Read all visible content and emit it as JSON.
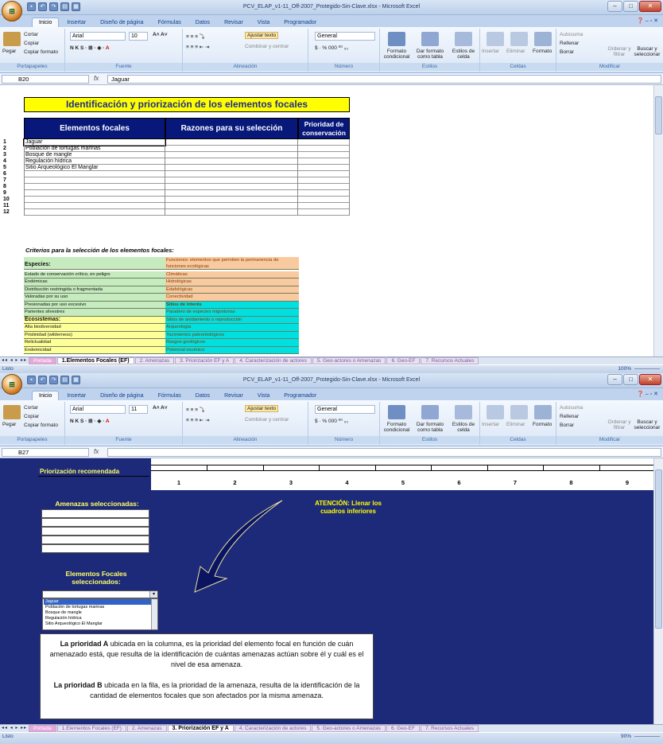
{
  "window1": {
    "title": "PCV_ELAP_v1-11_Off-2007_Protegido-Sin-Clave.xlsx - Microsoft Excel",
    "tabs": [
      "Inicio",
      "Insertar",
      "Diseño de página",
      "Fórmulas",
      "Datos",
      "Revisar",
      "Vista",
      "Programador"
    ],
    "ribbon": {
      "cortar": "Cortar",
      "copiar": "Copiar",
      "copiar_formato": "Copiar formato",
      "pegar": "Pegar",
      "font": "Arial",
      "size": "10",
      "ajustar": "Ajustar texto",
      "combinar": "Combinar y centrar",
      "general": "General",
      "formato_cond": "Formato condicional",
      "dar_formato": "Dar formato como tabla",
      "estilos_celda": "Estilos de celda",
      "insertar": "Insertar",
      "eliminar": "Eliminar",
      "formato": "Formato",
      "autosuma": "Autosuma",
      "rellenar": "Rellenar",
      "borrar": "Borrar",
      "ordenar": "Ordenar y filtrar",
      "buscar": "Buscar y seleccionar",
      "g_portapapeles": "Portapapeles",
      "g_fuente": "Fuente",
      "g_alineacion": "Alineación",
      "g_numero": "Número",
      "g_estilos": "Estilos",
      "g_celdas": "Celdas",
      "g_modificar": "Modificar"
    },
    "namebox": "B20",
    "formula": "Jaguar",
    "heading": "Identificación y priorización de los elementos focales",
    "col1": "Elementos focales",
    "col2": "Razones para su selección",
    "col3": "Prioridad de conservación",
    "rows": [
      {
        "n": "1",
        "v": "Jaguar"
      },
      {
        "n": "2",
        "v": "Población de tortugas marinas"
      },
      {
        "n": "3",
        "v": "Bosque de mangle"
      },
      {
        "n": "4",
        "v": "Regulación hídrica"
      },
      {
        "n": "5",
        "v": "Sitio Arqueológico El Manglar"
      },
      {
        "n": "6",
        "v": ""
      },
      {
        "n": "7",
        "v": ""
      },
      {
        "n": "8",
        "v": ""
      },
      {
        "n": "9",
        "v": ""
      },
      {
        "n": "10",
        "v": ""
      },
      {
        "n": "11",
        "v": ""
      },
      {
        "n": "12",
        "v": ""
      }
    ],
    "criteria_title": "Criterios para la selección de los elementos focales:",
    "crit_left": [
      "Especies:",
      "Estado de conservación crítico, en peligro",
      "Endémicas",
      "Distribución restringida o fragmentada",
      "Valoradas por su uso",
      "Presionadas por uso excesivo",
      "Parientes silvestres",
      "Ecosistemas:",
      "Alta biodiversidad",
      "Pristinidad (wilderness)",
      "Relictualidad",
      "Endemicidad"
    ],
    "crit_right_head": "Funciones: elementos que permiten la permanencia de funciones ecológicas",
    "crit_right": [
      "Climáticas",
      "Hidrológicas",
      "Edafológicas",
      "Conectividad",
      "Sitios de interés",
      "Paradero de especies migratorias",
      "Sitios de anidamiento o reproducción",
      "Arqueología",
      "Yacimientos paleontológicos",
      "Rasgos geológicos",
      "Potencial escénico"
    ],
    "sheet_tabs": [
      "Portada",
      "1.Elementos Focales (EF)",
      "2. Amenazas",
      "3. Priorización EF y A",
      "4. Caracterización de actores",
      "5. Geo-actores o Amenazas",
      "6. Geo-EF",
      "7. Recursos Actuales"
    ],
    "status": "Listo",
    "zoom": "100%"
  },
  "window2": {
    "title": "PCV_ELAP_v1-11_Off-2007_Protegido-Sin-Clave.xlsx - Microsoft Excel",
    "namebox": "B27",
    "formula": "",
    "size": "11",
    "priorizacion": "Priorización recomendada",
    "cols": [
      "1",
      "2",
      "3",
      "4",
      "5",
      "6",
      "7",
      "8",
      "9"
    ],
    "atencion": "ATENCIÓN: Llenar los cuadros inferiores",
    "amenazas": "Amenazas seleccionadas:",
    "focales": "Elementos Focales seleccionados:",
    "dropdown_items": [
      "Jaguar",
      "Población de tortugas marinas",
      "Bosque de mangle",
      "Regulación hídrica",
      "Sitio Arqueológico El Manglar"
    ],
    "prioA_bold": "La prioridad A",
    "prioA_rest": " ubicada en la columna, es la prioridad del elemento focal en función de cuán amenazado está, que resulta de la identificación de cuántas amenazas actúan sobre él y cuál es el nivel de esa amenaza.",
    "prioB_bold": "La prioridad B",
    "prioB_rest": " ubicada en la fila, es la prioridad de la amenaza, resulta de la identificación de la cantidad de elementos focales que son afectados por la misma amenaza.",
    "status": "Listo",
    "zoom": "90%"
  }
}
